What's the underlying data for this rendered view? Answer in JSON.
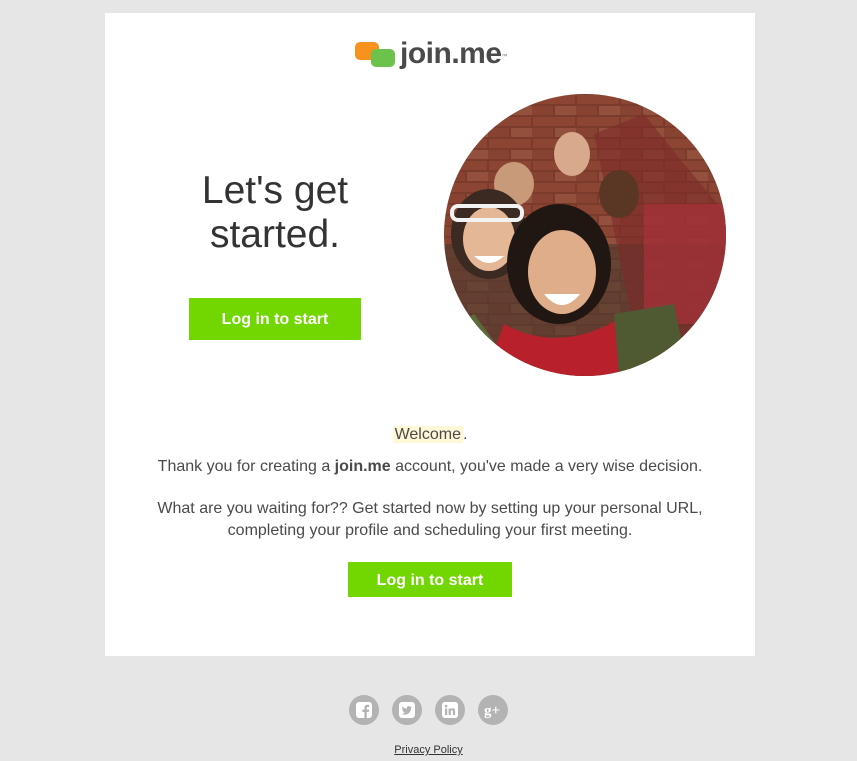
{
  "logo": {
    "text": "join.me",
    "tm": "™"
  },
  "headline": {
    "line1": "Let's get",
    "line2": "started."
  },
  "buttons": {
    "login_top": "Log in to start",
    "login_bottom": "Log in to start"
  },
  "welcome": {
    "word": "Welcome",
    "punct": "."
  },
  "paragraph1": {
    "before": "Thank you for creating a ",
    "brand": "join.me",
    "after": " account, you've made a very wise decision."
  },
  "paragraph2": {
    "line1": "What are you waiting for?? Get started now by setting up your personal URL,",
    "line2": "completing your profile and scheduling your first meeting."
  },
  "social": [
    "facebook-icon",
    "twitter-icon",
    "linkedin-icon",
    "google-plus-icon"
  ],
  "footer": {
    "privacy": "Privacy Policy"
  },
  "colors": {
    "accent": "#72d600",
    "logo_orange": "#f7931d",
    "logo_green": "#6cc24a",
    "background": "#e6e6e6",
    "icon_gray": "#b3b3b3"
  }
}
